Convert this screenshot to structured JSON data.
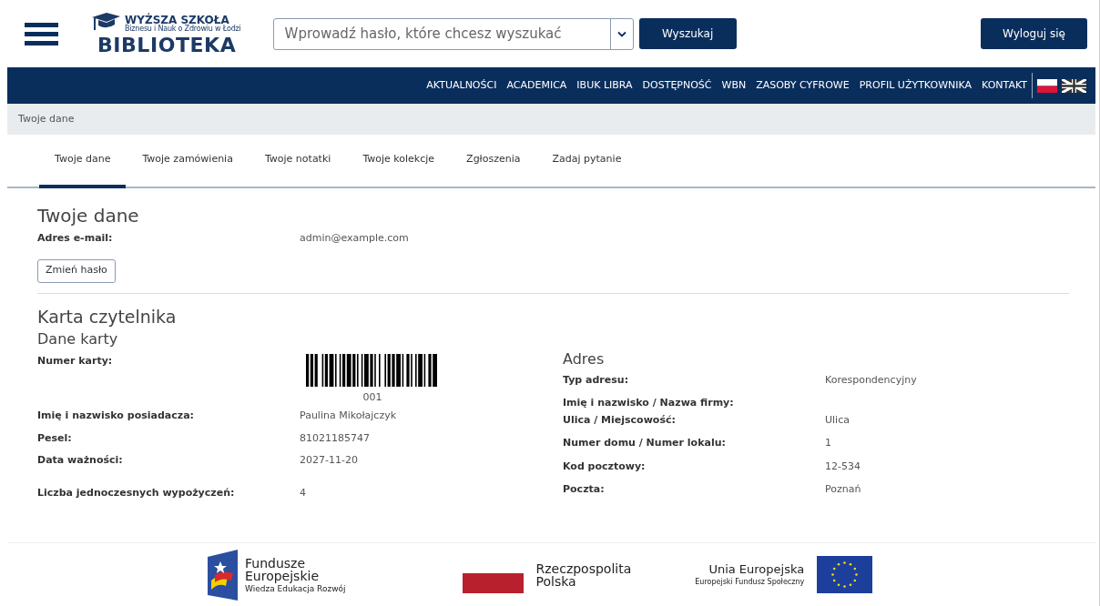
{
  "header": {
    "logo_top": "WYŻSZA SZKOŁA",
    "logo_sub": "Biznesu i Nauk o Zdrowiu w Łodzi",
    "logo_main": "BIBLIOTEKA",
    "search": {
      "placeholder": "Wprowadź hasło, które chcesz wyszukać"
    },
    "search_button": "Wyszukaj",
    "logout_button": "Wyloguj się"
  },
  "nav": [
    "AKTUALNOŚCI",
    "ACADEMICA",
    "IBUK LIBRA",
    "DOSTĘPNOŚĆ",
    "WBN",
    "ZASOBY CYFROWE",
    "PROFIL UŻYTKOWNIKA",
    "KONTAKT"
  ],
  "breadcrumb": "Twoje dane",
  "tabs": [
    {
      "label": "Twoje dane",
      "selected": true
    },
    {
      "label": "Twoje zamówienia",
      "selected": false
    },
    {
      "label": "Twoje notatki",
      "selected": false
    },
    {
      "label": "Twoje kolekcje",
      "selected": false
    },
    {
      "label": "Zgłoszenia",
      "selected": false
    },
    {
      "label": "Zadaj pytanie",
      "selected": false
    }
  ],
  "your_data": {
    "title": "Twoje dane",
    "email_label": "Adres e-mail:",
    "email": "admin@example.com",
    "change_password": "Zmień hasło"
  },
  "card": {
    "title": "Karta czytelnika",
    "card_data": {
      "title": "Dane karty",
      "number_label": "Numer karty:",
      "number": "001",
      "rows": [
        {
          "label": "Imię i nazwisko posiadacza:",
          "value": "Paulina Mikołajczyk"
        },
        {
          "label": "Pesel:",
          "value": "81021185747"
        },
        {
          "label": "Data ważności:",
          "value": "2027-11-20"
        }
      ],
      "loans_label": "Liczba jednoczesnych wypożyczeń:",
      "loans": "4"
    },
    "address": {
      "title": "Adres",
      "rows": [
        {
          "label": "Typ adresu:",
          "value": "Korespondencyjny"
        },
        {
          "label": "Imię i nazwisko / Nazwa firmy:"
        },
        {
          "label": "Ulica / Miejscowość:",
          "value": "Ulica"
        },
        {
          "label": "Numer domu / Numer lokalu:",
          "value": "1"
        },
        {
          "label": "Kod pocztowy:",
          "value": "12-534"
        },
        {
          "label": "Poczta:",
          "value": "Poznań"
        }
      ]
    }
  },
  "footer": {
    "fe": [
      "Fundusze",
      "Europejskie",
      "Wiedza Edukacja Rozwój"
    ],
    "rp": [
      "Rzeczpospolita",
      "Polska"
    ],
    "ue": [
      "Unia Europejska",
      "Europejski Fundusz Społeczny"
    ]
  }
}
